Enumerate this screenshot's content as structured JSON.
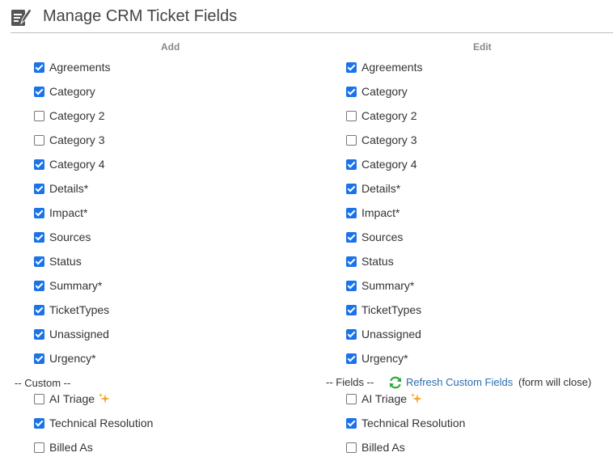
{
  "header": {
    "title": "Manage CRM Ticket Fields",
    "icon": "edit-note-icon"
  },
  "columns": {
    "add": "Add",
    "edit": "Edit"
  },
  "fields": [
    {
      "label": "Agreements",
      "add": true,
      "edit": true
    },
    {
      "label": "Category",
      "add": true,
      "edit": true
    },
    {
      "label": "Category 2",
      "add": false,
      "edit": false
    },
    {
      "label": "Category 3",
      "add": false,
      "edit": false
    },
    {
      "label": "Category 4",
      "add": true,
      "edit": true
    },
    {
      "label": "Details*",
      "add": true,
      "edit": true
    },
    {
      "label": "Impact*",
      "add": true,
      "edit": true
    },
    {
      "label": "Sources",
      "add": true,
      "edit": true
    },
    {
      "label": "Status",
      "add": true,
      "edit": true
    },
    {
      "label": "Summary*",
      "add": true,
      "edit": true
    },
    {
      "label": "TicketTypes",
      "add": true,
      "edit": true
    },
    {
      "label": "Unassigned",
      "add": true,
      "edit": true
    },
    {
      "label": "Urgency*",
      "add": true,
      "edit": true
    }
  ],
  "custom": {
    "left_separator": "-- Custom --",
    "right_separator": "-- Fields --",
    "refresh_label": "Refresh Custom Fields",
    "refresh_note": "(form will close)",
    "fields": [
      {
        "label": "AI Triage",
        "add": false,
        "edit": false,
        "icon": "sparkle-icon"
      },
      {
        "label": "Technical Resolution",
        "add": true,
        "edit": true
      },
      {
        "label": "Billed As",
        "add": false,
        "edit": false
      }
    ]
  },
  "colors": {
    "accent": "#1a73e8",
    "link": "#2a6db0",
    "refresh": "#2eaa3c",
    "sparkle": "#f5a623"
  }
}
